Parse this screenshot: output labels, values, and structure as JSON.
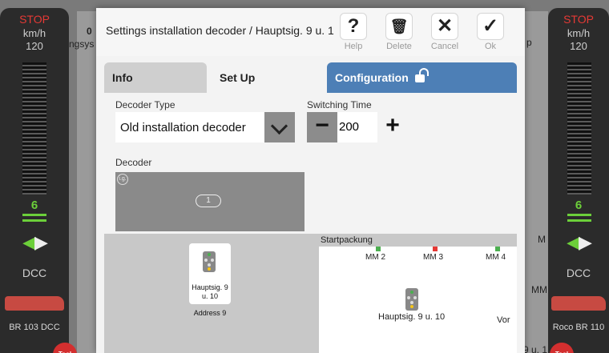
{
  "left_controller": {
    "stop": "STOP",
    "unit": "km/h",
    "max_speed": "120",
    "step": "6",
    "protocol": "DCC",
    "loco_name": "BR 103 DCC",
    "horn_label": "Tool"
  },
  "right_controller": {
    "stop": "STOP",
    "unit": "km/h",
    "max_speed": "120",
    "step": "6",
    "protocol": "DCC",
    "loco_name": "Roco BR 110",
    "horn_label": "Tool"
  },
  "background": {
    "peek_0": "0",
    "peek_ngs": "ngsys",
    "peek_p": "p",
    "peek_m1": "M",
    "peek_mm": "MM",
    "peek_9u": "9 u. 1"
  },
  "modal": {
    "title": "Settings installation decoder / Hauptsig. 9 u. 1",
    "toolbar": {
      "help_label": "Help",
      "help_icon": "?",
      "delete_label": "Delete",
      "delete_icon": "🗑",
      "cancel_label": "Cancel",
      "cancel_icon": "✕",
      "ok_label": "Ok",
      "ok_icon": "✓"
    },
    "tabs": {
      "info": "Info",
      "setup": "Set Up",
      "configuration": "Configuration"
    },
    "decoder_type": {
      "label": "Decoder Type",
      "value": "Old installation decoder"
    },
    "switching_time": {
      "label": "Switching Time",
      "value": "200",
      "minus": "−",
      "plus": "+"
    },
    "decoder": {
      "label": "Decoder",
      "tag": "i.g.",
      "slot": "1"
    },
    "signal": {
      "name": "Hauptsig. 9 u. 10",
      "address": "Address 9"
    },
    "startpackung": {
      "label": "Startpackung",
      "mm2": "MM 2",
      "mm3": "MM 3",
      "mm4": "MM 4",
      "signal_name": "Hauptsig. 9 u. 10",
      "vor": "Vor"
    }
  },
  "colors": {
    "accent_blue": "#4d7fb6",
    "stop_red": "#e53935",
    "speed_green": "#6ccf3a"
  }
}
